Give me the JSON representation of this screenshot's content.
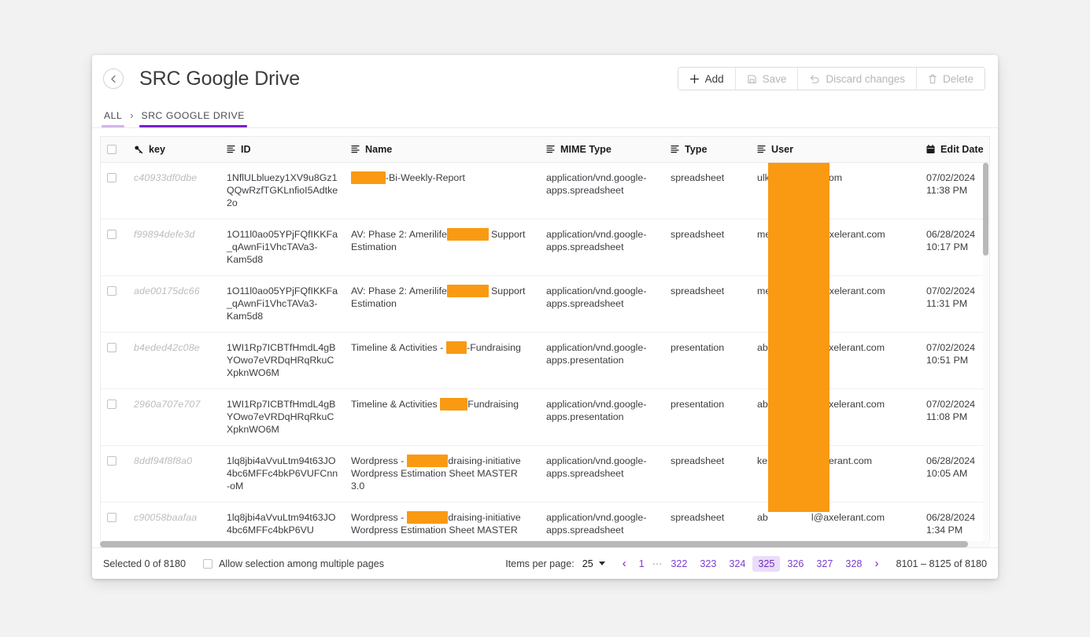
{
  "header": {
    "back_icon": "arrow-left-circle-icon",
    "title": "SRC Google Drive",
    "toolbar": {
      "add_label": "Add",
      "save_label": "Save",
      "discard_label": "Discard changes",
      "delete_label": "Delete"
    }
  },
  "breadcrumb": {
    "root_label": "ALL",
    "separator": "›",
    "current_label": "SRC GOOGLE DRIVE"
  },
  "table": {
    "columns": [
      {
        "label": "key",
        "icon": "key-icon"
      },
      {
        "label": "ID",
        "icon": "text-lines-icon"
      },
      {
        "label": "Name",
        "icon": "text-lines-icon"
      },
      {
        "label": "MIME Type",
        "icon": "text-lines-icon"
      },
      {
        "label": "Type",
        "icon": "text-lines-icon"
      },
      {
        "label": "User",
        "icon": "text-lines-icon"
      },
      {
        "label": "Edit Date",
        "icon": "calendar-icon"
      }
    ],
    "rows": [
      {
        "key": "c40933df0dbe",
        "id": "1NflULbluezy1XV9u8Gz1QQwRzfTGKLnfioI5Adtke2o",
        "name_prefix": "",
        "name_redacted": "█████",
        "name_suffix": "-Bi-Weekly-Report",
        "mime": "application/vnd.google-apps.spreadsheet",
        "type": "spreadsheet",
        "user_prefix": "ulk",
        "user_suffix": "nt.com",
        "date": "07/02/2024",
        "time": "11:38 PM"
      },
      {
        "key": "f99894defe3d",
        "id": "1O11l0ao05YPjFQfIKKFa_qAwnFi1VhcTAVa3-Kam5d8",
        "name_prefix": "AV: Phase 2: Amerilife",
        "name_redacted": "██████",
        "name_suffix": " Support Estimation",
        "mime": "application/vnd.google-apps.spreadsheet",
        "type": "spreadsheet",
        "user_prefix": "me",
        "user_suffix": "@axelerant.com",
        "date": "06/28/2024",
        "time": "10:17 PM"
      },
      {
        "key": "ade00175dc66",
        "id": "1O11l0ao05YPjFQfIKKFa_qAwnFi1VhcTAVa3-Kam5d8",
        "name_prefix": "AV: Phase 2: Amerilife",
        "name_redacted": "██████",
        "name_suffix": " Support Estimation",
        "mime": "application/vnd.google-apps.spreadsheet",
        "type": "spreadsheet",
        "user_prefix": "me",
        "user_suffix": "@axelerant.com",
        "date": "07/02/2024",
        "time": "11:31 PM"
      },
      {
        "key": "b4eded42c08e",
        "id": "1WI1Rp7ICBTfHmdL4gBYOwo7eVRDqHRqRkuCXpknWO6M",
        "name_prefix": "Timeline & Activities - ",
        "name_redacted": "███",
        "name_suffix": "-Fundraising",
        "mime": "application/vnd.google-apps.presentation",
        "type": "presentation",
        "user_prefix": "ab",
        "user_suffix": "l@axelerant.com",
        "date": "07/02/2024",
        "time": "10:51 PM"
      },
      {
        "key": "2960a707e707",
        "id": "1WI1Rp7ICBTfHmdL4gBYOwo7eVRDqHRqRkuCXpknWO6M",
        "name_prefix": "Timeline & Activities ",
        "name_redacted": "████",
        "name_suffix": "Fundraising",
        "mime": "application/vnd.google-apps.presentation",
        "type": "presentation",
        "user_prefix": "ab",
        "user_suffix": "l@axelerant.com",
        "date": "07/02/2024",
        "time": "11:08 PM"
      },
      {
        "key": "8ddf94f8f8a0",
        "id": "1lq8jbi4aVvuLtm94t63JO4bc6MFFc4bkP6VUFCnn-oM",
        "name_prefix": "Wordpress - ",
        "name_redacted": "██████",
        "name_suffix": "draising-initiative Wordpress Estimation Sheet MASTER 3.0",
        "mime": "application/vnd.google-apps.spreadsheet",
        "type": "spreadsheet",
        "user_prefix": "ke",
        "user_suffix": "axelerant.com",
        "date": "06/28/2024",
        "time": "10:05 AM"
      },
      {
        "key": "c90058baafaa",
        "id": "1lq8jbi4aVvuLtm94t63JO4bc6MFFc4bkP6VU",
        "name_prefix": "Wordpress - ",
        "name_redacted": "██████",
        "name_suffix": "draising-initiative Wordpress Estimation Sheet MASTER",
        "mime": "application/vnd.google-apps.spreadsheet",
        "type": "spreadsheet",
        "user_prefix": "ab",
        "user_suffix": "l@axelerant.com",
        "date": "06/28/2024",
        "time": "1:34 PM"
      }
    ]
  },
  "footer": {
    "selected_text": "Selected 0 of 8180",
    "allow_selection_label": "Allow selection among multiple pages",
    "items_per_page_label": "Items per page:",
    "items_per_page_value": "25",
    "prev_arrow": "‹",
    "next_arrow": "›",
    "first_page": "1",
    "ellipsis": "⋯",
    "pages": [
      "322",
      "323",
      "324",
      "325",
      "326",
      "327",
      "328"
    ],
    "active_page": "325",
    "range_text": "8101 – 8125 of 8180"
  },
  "colors": {
    "accent": "#7b1fd4",
    "accent_pale": "#d4b5ee",
    "active_page_bg": "#ebdcfa",
    "redaction": "#F99A12",
    "page_background": "#f2f2f2"
  }
}
